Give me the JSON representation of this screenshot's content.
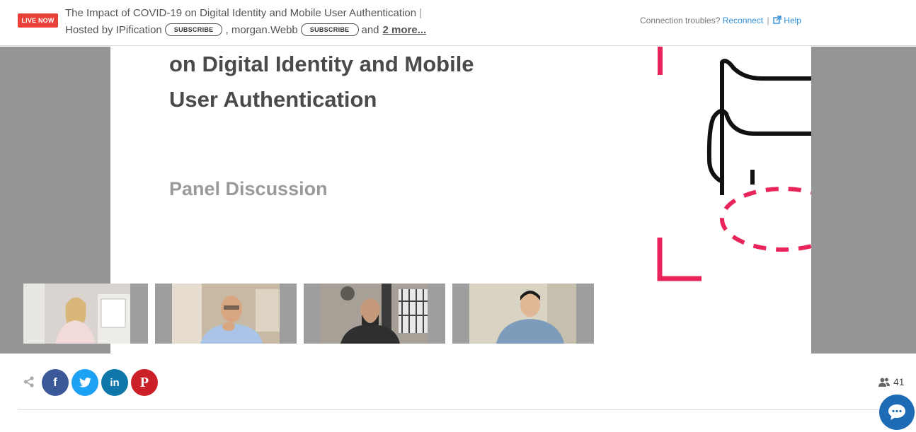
{
  "header": {
    "live_badge": "LIVE NOW",
    "title": "The Impact of COVID-19 on Digital Identity and Mobile User Authentication",
    "title_separator": "|",
    "hosted_by_prefix": "Hosted by",
    "host1": "IPification",
    "subscribe_label": "SUBSCRIBE",
    "host2_prefix": ",",
    "host2": "morgan.Webb",
    "and_text": "and",
    "more_link": "2 more...",
    "connection_text": "Connection troubles?",
    "reconnect_label": "Reconnect",
    "divider": "|",
    "help_label": "Help"
  },
  "slide": {
    "heading_line1": "on Digital Identity and Mobile",
    "heading_line2": "User Authentication",
    "subheading": "Panel Discussion"
  },
  "participants": [
    {
      "label": "participant-1"
    },
    {
      "label": "participant-2"
    },
    {
      "label": "participant-3"
    },
    {
      "label": "participant-4"
    }
  ],
  "share": {
    "icons": [
      "share-icon",
      "facebook-icon",
      "twitter-icon",
      "linkedin-icon",
      "pinterest-icon"
    ],
    "facebook_glyph": "f",
    "linkedin_glyph": "in",
    "pinterest_glyph": "P",
    "viewer_count": "41"
  },
  "colors": {
    "live": "#e8413a",
    "link": "#2e8fd8",
    "facebook": "#3b5998",
    "twitter": "#1da1f2",
    "linkedin": "#0e76a8",
    "pinterest": "#cb2027",
    "chat": "#1d6bb5",
    "accent_pink": "#e8245a"
  }
}
